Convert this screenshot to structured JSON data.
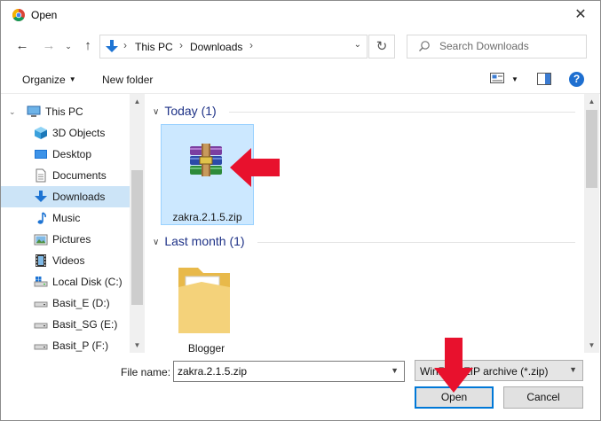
{
  "window": {
    "title": "Open",
    "close_glyph": "✕"
  },
  "nav": {
    "back_glyph": "←",
    "forward_glyph": "→",
    "up_glyph": "↑",
    "refresh_glyph": "↻"
  },
  "address": {
    "crumbs": [
      "This PC",
      "Downloads"
    ],
    "separator": "›",
    "dropdown_glyph": "⌄"
  },
  "search": {
    "placeholder": "Search Downloads"
  },
  "toolbar": {
    "organize_label": "Organize",
    "new_folder_label": "New folder",
    "help_glyph": "?"
  },
  "sidebar": {
    "items": [
      {
        "label": "This PC",
        "icon": "pc-icon"
      },
      {
        "label": "3D Objects",
        "icon": "3d-objects-icon"
      },
      {
        "label": "Desktop",
        "icon": "desktop-icon"
      },
      {
        "label": "Documents",
        "icon": "documents-icon"
      },
      {
        "label": "Downloads",
        "icon": "downloads-icon",
        "selected": true
      },
      {
        "label": "Music",
        "icon": "music-icon"
      },
      {
        "label": "Pictures",
        "icon": "pictures-icon"
      },
      {
        "label": "Videos",
        "icon": "videos-icon"
      },
      {
        "label": "Local Disk (C:)",
        "icon": "drive-icon"
      },
      {
        "label": "Basit_E (D:)",
        "icon": "drive-icon"
      },
      {
        "label": "Basit_SG (E:)",
        "icon": "drive-icon"
      },
      {
        "label": "Basit_P (F:)",
        "icon": "drive-icon"
      }
    ]
  },
  "content": {
    "groups": [
      {
        "header": "Today (1)",
        "files": [
          {
            "name": "zakra.2.1.5.zip",
            "icon": "winrar-archive-icon",
            "selected": true
          }
        ]
      },
      {
        "header": "Last month (1)",
        "files": [
          {
            "name": "Blogger",
            "icon": "folder-icon",
            "selected": false
          }
        ]
      }
    ]
  },
  "footer": {
    "file_name_label": "File name:",
    "file_name_value": "zakra.2.1.5.zip",
    "file_type_value": "WinRAR ZIP archive (*.zip)",
    "open_label": "Open",
    "cancel_label": "Cancel"
  },
  "colors": {
    "accent": "#0078d7",
    "selection": "#cce8ff",
    "annotation_arrow": "#e8112d",
    "group_header": "#1e3287"
  }
}
